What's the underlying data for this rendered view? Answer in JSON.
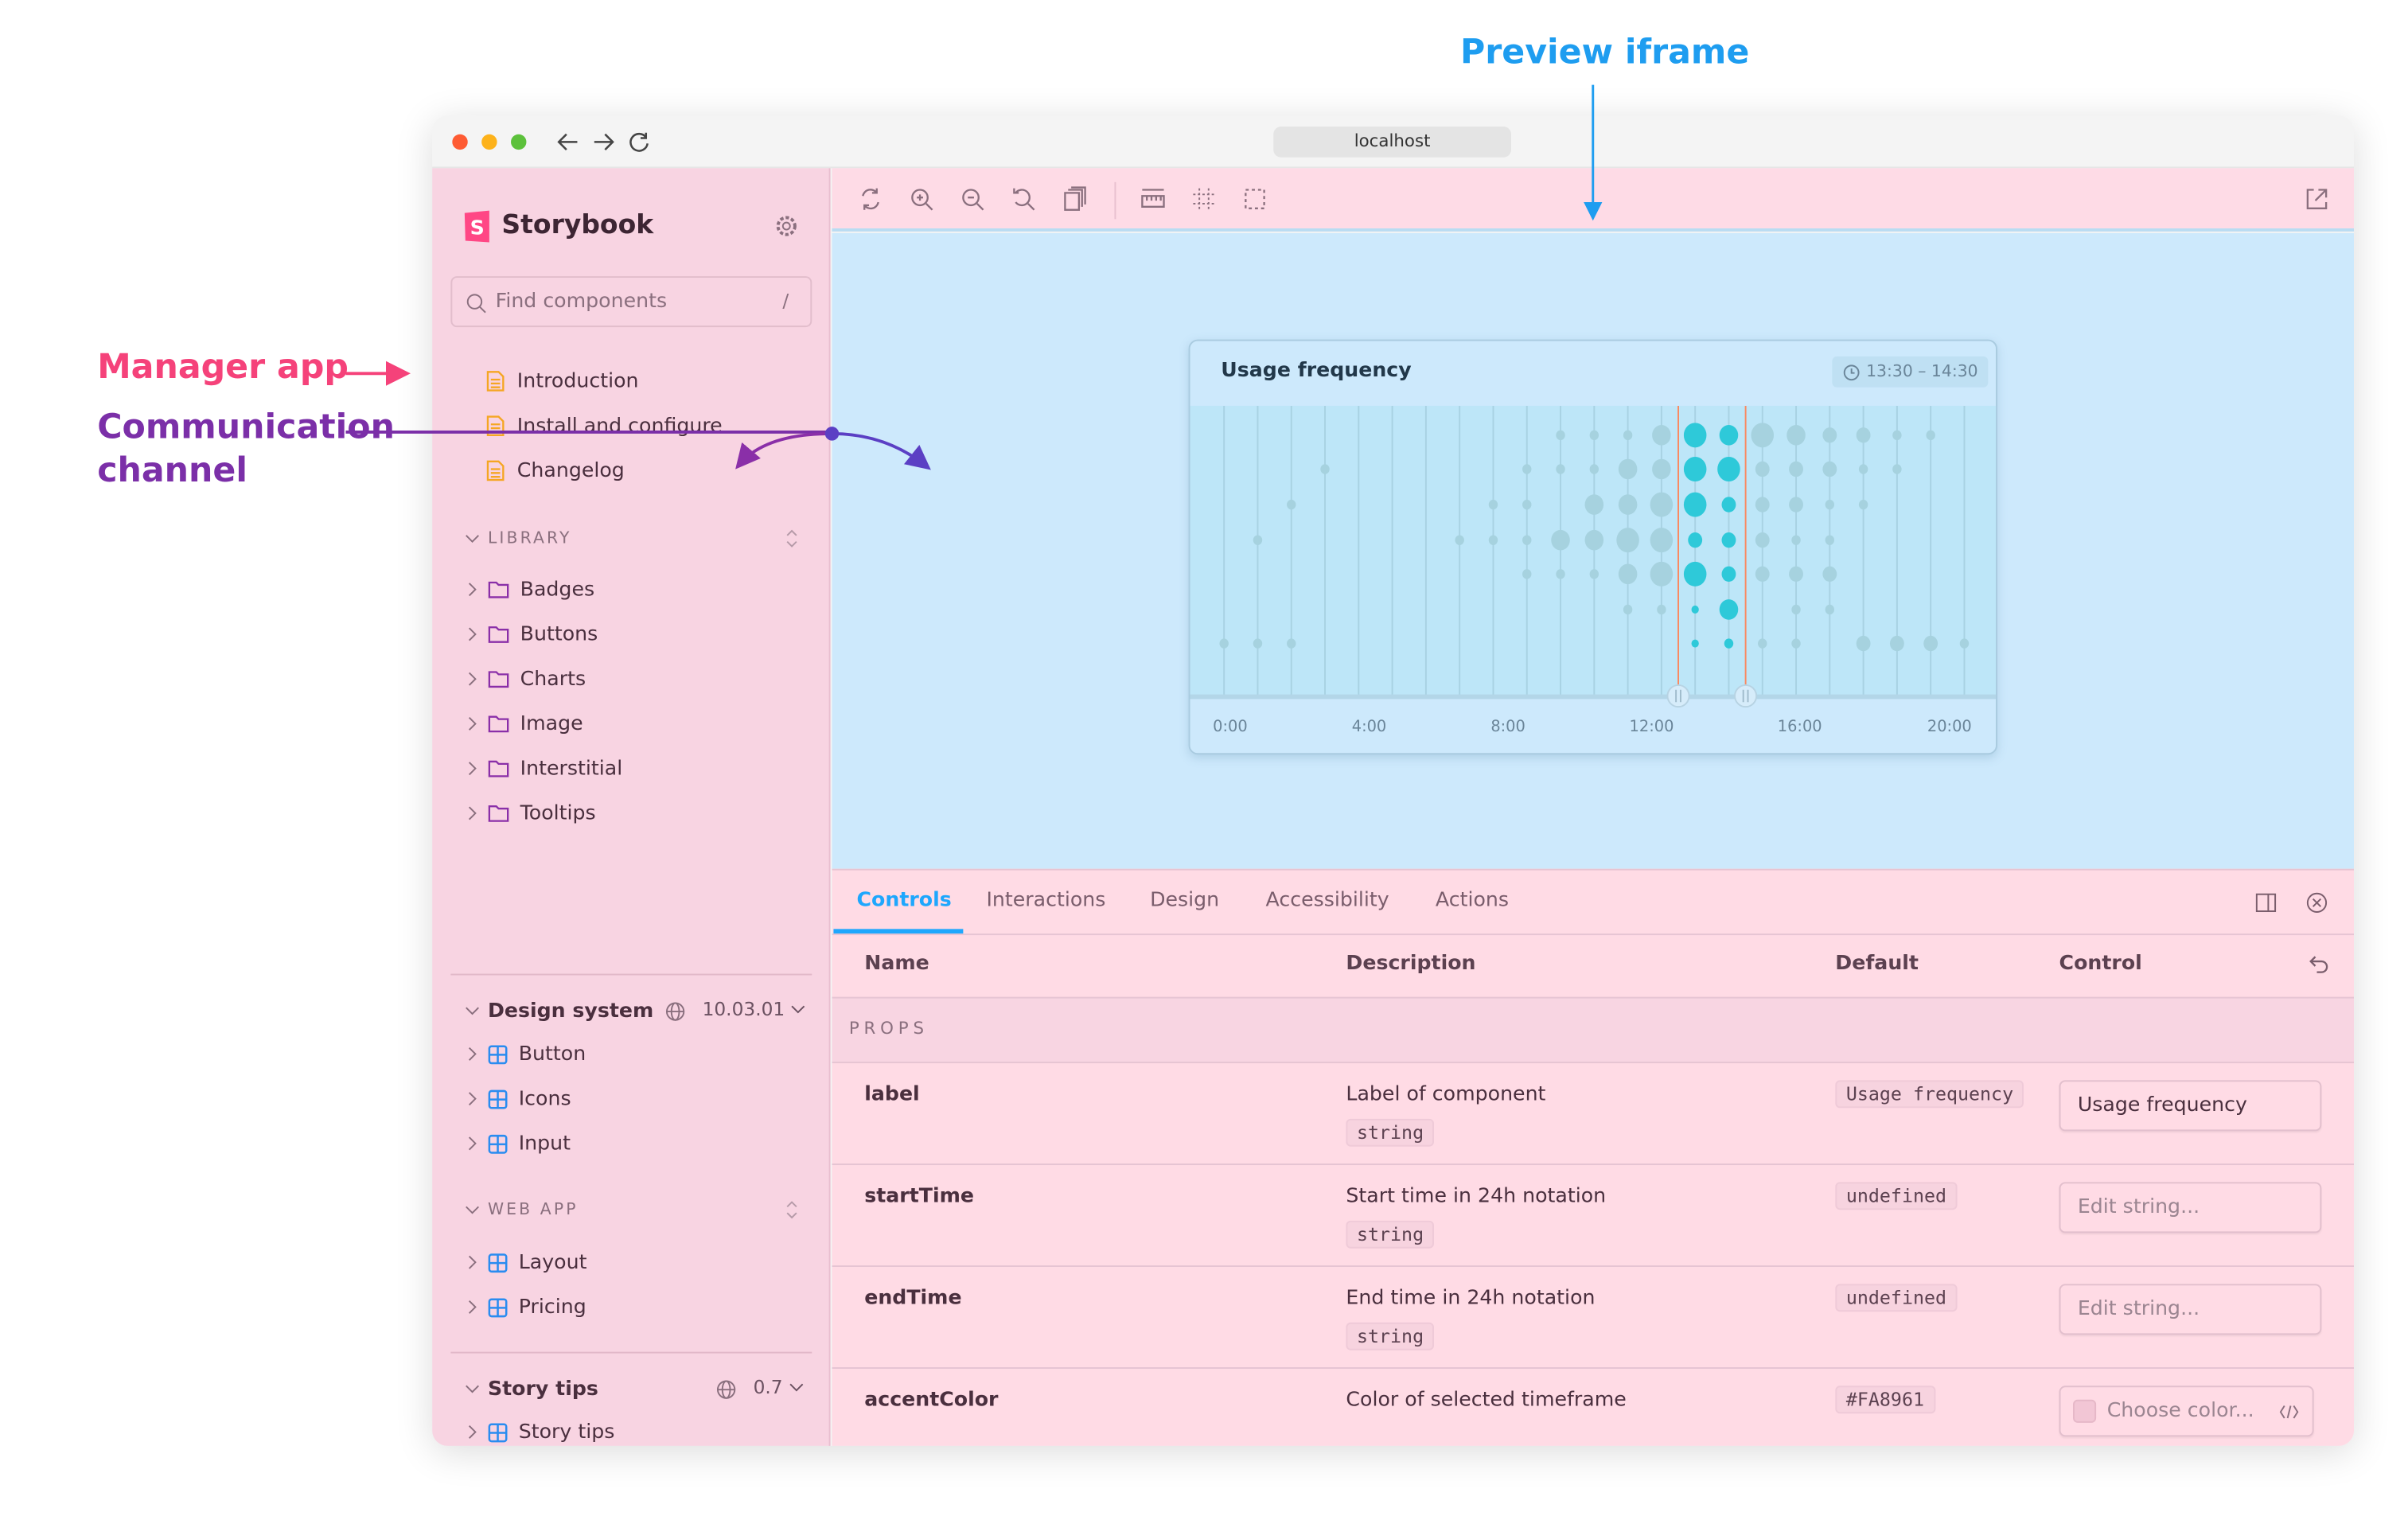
{
  "annotations": {
    "manager_app": "Manager app",
    "communication_channel_line1": "Communication",
    "communication_channel_line2": "channel",
    "preview_iframe": "Preview iframe",
    "colors": {
      "manager": "#F5427A",
      "channel": "#7B2FA8",
      "preview": "#1E9DF0"
    }
  },
  "browser": {
    "url": "localhost"
  },
  "sidebar": {
    "brand": "Storybook",
    "search_placeholder": "Find components",
    "search_shortcut": "/",
    "docs": [
      "Introduction",
      "Install and configure",
      "Changelog"
    ],
    "library": {
      "title": "LIBRARY",
      "items": [
        "Badges",
        "Buttons",
        "Charts",
        "Image",
        "Interstitial",
        "Tooltips"
      ]
    },
    "design_system": {
      "title": "Design system",
      "version": "10.03.01",
      "items": [
        "Button",
        "Icons",
        "Input"
      ]
    },
    "web_app": {
      "title": "WEB APP",
      "items": [
        "Layout",
        "Pricing"
      ]
    },
    "story_tips": {
      "title": "Story tips",
      "version": "0.7",
      "items": [
        "Story tips"
      ]
    }
  },
  "toolbar": {
    "icons": [
      "remount-icon",
      "zoom-in-icon",
      "zoom-out-icon",
      "zoom-reset-icon",
      "background-icon",
      "viewport-ruler-icon",
      "grid-icon",
      "outline-icon"
    ],
    "open_new_tab": "open-in-new-tab-icon"
  },
  "chart_data": {
    "type": "scatter",
    "title": "Usage frequency",
    "range_badge": "13:30 – 14:30",
    "x_tick_labels": [
      "0:00",
      "4:00",
      "8:00",
      "12:00",
      "16:00",
      "20:00"
    ],
    "columns": 23,
    "selected_columns": [
      14,
      15
    ],
    "accent_color": "#FA8961",
    "highlight_color": "#2EC9D9",
    "base_color": "#A6D2DF",
    "size_scale": "0 = none, 1 = smallest … 5 = largest",
    "rows": [
      [
        0,
        0,
        0,
        0,
        0,
        0,
        0,
        0,
        0,
        0,
        2,
        2,
        2,
        4,
        5,
        4,
        5,
        4,
        3,
        3,
        2,
        2,
        0
      ],
      [
        0,
        0,
        0,
        2,
        0,
        0,
        0,
        0,
        0,
        2,
        2,
        2,
        4,
        4,
        5,
        5,
        3,
        3,
        3,
        2,
        2,
        0,
        0
      ],
      [
        0,
        0,
        2,
        0,
        0,
        0,
        0,
        0,
        2,
        2,
        0,
        4,
        4,
        5,
        5,
        3,
        3,
        3,
        2,
        2,
        0,
        0,
        0
      ],
      [
        0,
        2,
        0,
        0,
        0,
        0,
        0,
        2,
        2,
        2,
        4,
        4,
        5,
        5,
        3,
        3,
        3,
        2,
        2,
        0,
        0,
        0,
        0
      ],
      [
        0,
        0,
        0,
        0,
        0,
        0,
        0,
        0,
        0,
        2,
        2,
        2,
        4,
        5,
        5,
        3,
        3,
        3,
        3,
        0,
        0,
        0,
        0
      ],
      [
        0,
        0,
        0,
        0,
        0,
        0,
        0,
        0,
        0,
        0,
        0,
        0,
        2,
        2,
        1,
        4,
        0,
        2,
        2,
        0,
        0,
        0,
        0
      ],
      [
        2,
        2,
        2,
        0,
        0,
        0,
        0,
        0,
        0,
        0,
        0,
        0,
        0,
        0,
        1,
        2,
        2,
        2,
        0,
        3,
        3,
        3,
        2
      ]
    ]
  },
  "panel": {
    "tabs": [
      "Controls",
      "Interactions",
      "Design",
      "Accessibility",
      "Actions"
    ],
    "active_tab": "Controls",
    "headers": {
      "name": "Name",
      "description": "Description",
      "default": "Default",
      "control": "Control"
    },
    "section": "PROPS",
    "rows": [
      {
        "name": "label",
        "description": "Label of component",
        "type": "string",
        "default": "Usage frequency",
        "control": "Usage frequency"
      },
      {
        "name": "startTime",
        "description": "Start time in 24h notation",
        "type": "string",
        "default": "undefined",
        "control_placeholder": "Edit string..."
      },
      {
        "name": "endTime",
        "description": "End time in 24h notation",
        "type": "string",
        "default": "undefined",
        "control_placeholder": "Edit string..."
      },
      {
        "name": "accentColor",
        "description": "Color of selected timeframe",
        "default": "#FA8961",
        "control_placeholder": "Choose color..."
      }
    ]
  }
}
